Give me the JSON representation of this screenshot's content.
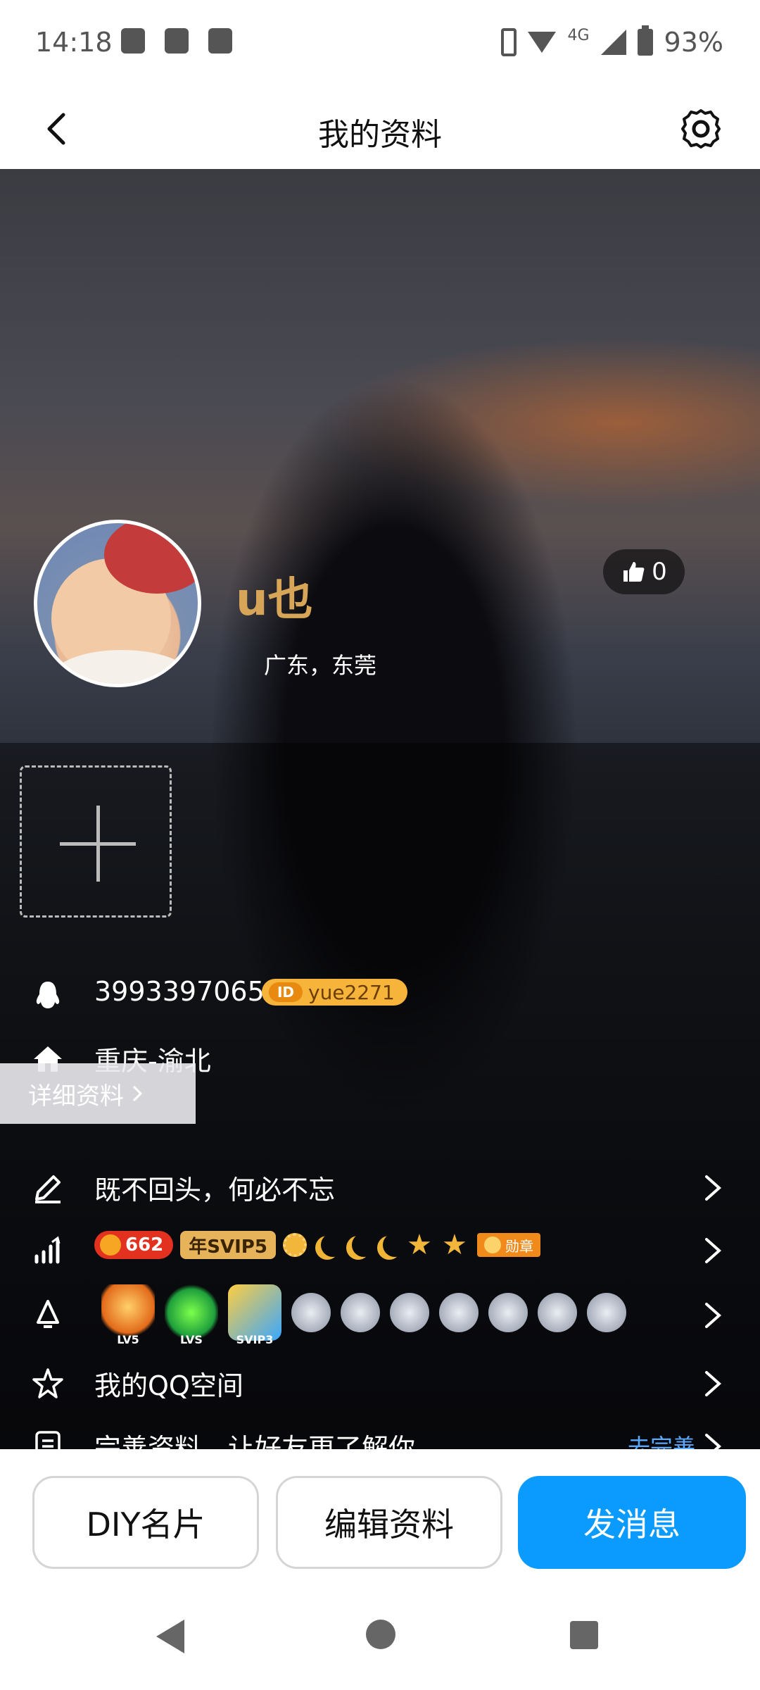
{
  "status_bar": {
    "time": "14:18",
    "network": "4G",
    "battery": "93%"
  },
  "header": {
    "title": "我的资料"
  },
  "profile": {
    "name": "u也",
    "location": "广东，东莞",
    "likes": "0",
    "qq_number": "3993397065",
    "qq_id": "yue2271",
    "hometown": "重庆-渝北",
    "detail_label": "详细资料",
    "signature": "既不回头，何必不忘"
  },
  "badges": {
    "level": "662",
    "svip": "年SVIP5",
    "medal": "勋章"
  },
  "game_icons": {
    "lv5": "LV5",
    "lvs": "LVS",
    "svip3": "SVIP3"
  },
  "rows": {
    "qzone": "我的QQ空间",
    "complete_profile": "完善资料，让好友更了解你",
    "complete_link": "去完善"
  },
  "actions": {
    "diy": "DIY名片",
    "edit": "编辑资料",
    "send": "发消息"
  },
  "colors": {
    "accent": "#0b9bff",
    "username": "#d7a557",
    "link": "#5aa8ff"
  }
}
